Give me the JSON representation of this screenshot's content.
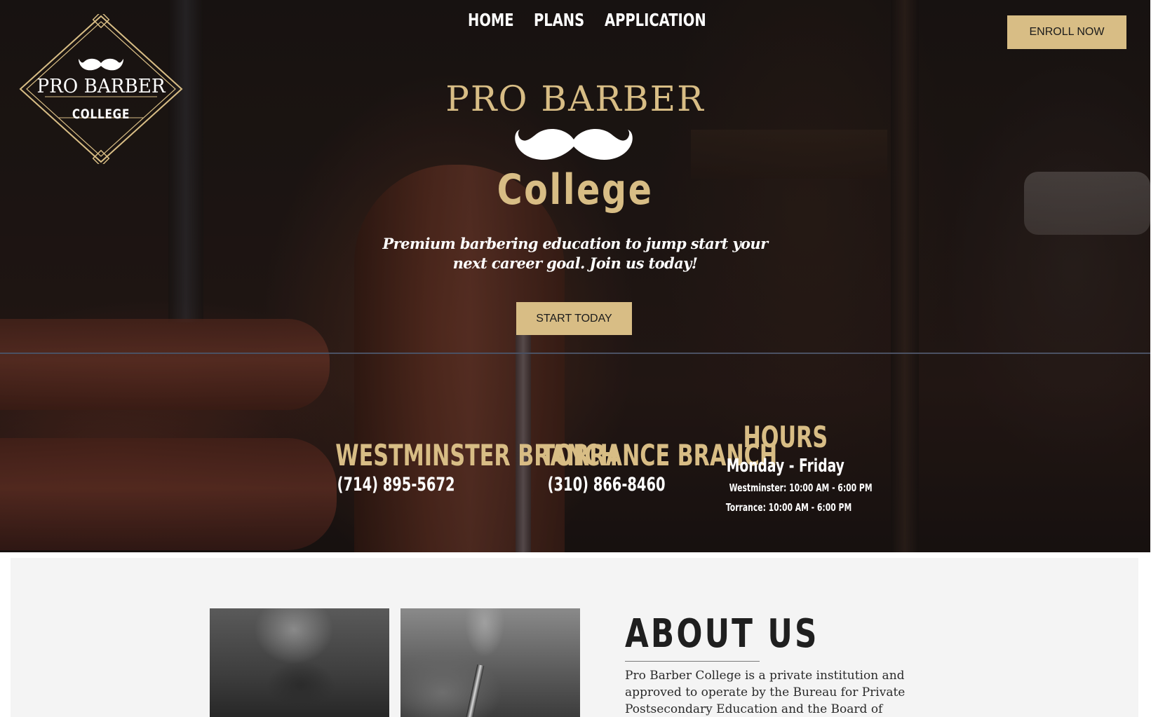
{
  "nav": {
    "items": [
      {
        "label": "HOME"
      },
      {
        "label": "PLANS"
      },
      {
        "label": "APPLICATION"
      }
    ],
    "enroll_label": "ENROLL NOW"
  },
  "logo": {
    "line1": "PRO BARBER",
    "line2": "COLLEGE"
  },
  "hero": {
    "title_line1": "PRO BARBER",
    "title_line2": "College",
    "tagline": "Premium barbering education to jump start your next career goal. Join us today!",
    "cta_label": "START TODAY"
  },
  "branches": [
    {
      "name": "WESTMINSTER BRANCH",
      "phone": "(714) 895-5672"
    },
    {
      "name": "TORRANCE BRANCH",
      "phone": "(310) 866-8460"
    }
  ],
  "hours": {
    "title": "HOURS",
    "days": "Monday - Friday",
    "westminster": "Westminster: 10:00 AM - 6:00 PM",
    "torrance": "Torrance: 10:00 AM - 6:00 PM"
  },
  "about": {
    "title": "ABOUT US",
    "text": "Pro Barber College is a private institution and approved to operate by the Bureau for Private Postsecondary Education and the Board of"
  },
  "colors": {
    "gold": "#d8bd85",
    "hero_dark": "#1d1715",
    "about_bg": "#f4f4f4"
  },
  "icons": {
    "logo_mustache": "mustache-icon",
    "hero_mustache": "mustache-icon"
  }
}
